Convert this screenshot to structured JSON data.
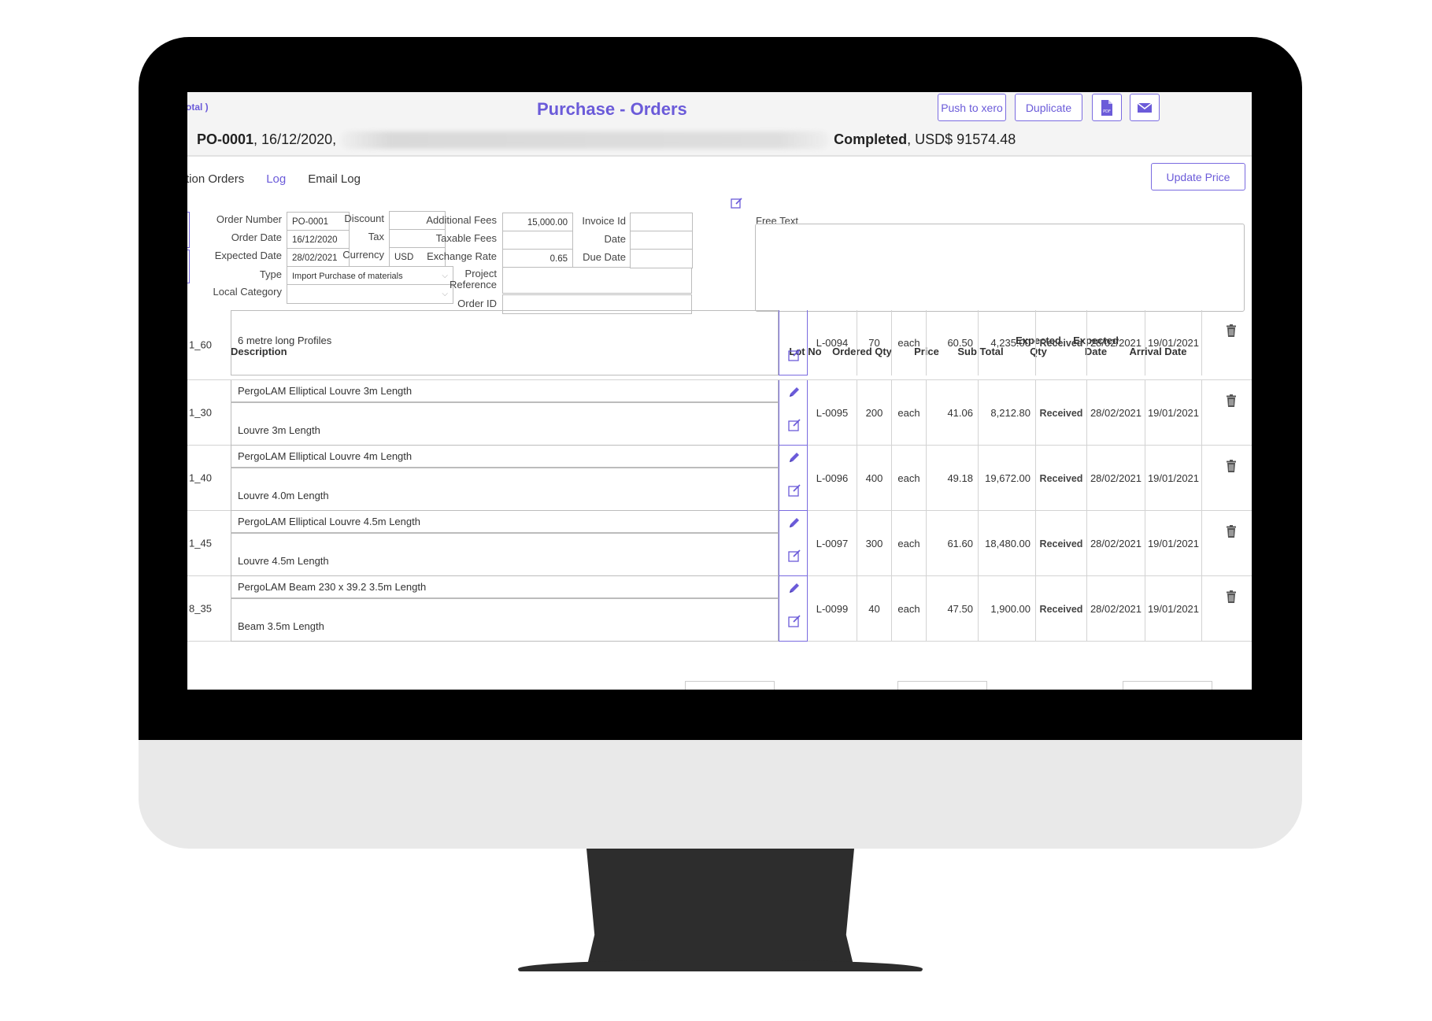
{
  "header": {
    "breadcrumb": "otal )",
    "title": "Purchase - Orders",
    "buttons": {
      "push_to_xero": "Push to xero",
      "duplicate": "Duplicate"
    },
    "po_number": "PO-0001",
    "po_date": ", 16/12/2020,",
    "status": "Completed",
    "amount": ", USD$ 91574.48"
  },
  "tabs": [
    {
      "label": "tion Orders",
      "active": false
    },
    {
      "label": "Log",
      "active": true
    },
    {
      "label": "Email Log",
      "active": false
    }
  ],
  "update_price_label": "Update Price",
  "form": {
    "order_number": {
      "label": "Order Number",
      "value": "PO-0001"
    },
    "order_date": {
      "label": "Order Date",
      "value": "16/12/2020"
    },
    "expected_date": {
      "label": "Expected Date",
      "value": "28/02/2021"
    },
    "type": {
      "label": "Type",
      "value": "Import Purchase of materials"
    },
    "local_category": {
      "label": "Local Category",
      "value": ""
    },
    "discount": {
      "label": "Discount",
      "value": ""
    },
    "tax": {
      "label": "Tax",
      "value": ""
    },
    "currency": {
      "label": "Currency",
      "value": "USD"
    },
    "additional_fees": {
      "label": "Additional Fees",
      "value": "15,000.00"
    },
    "taxable_fees": {
      "label": "Taxable Fees",
      "value": ""
    },
    "exchange_rate": {
      "label": "Exchange Rate",
      "value": "0.65"
    },
    "project_reference": {
      "label1": "Project",
      "label2": "Reference",
      "value": ""
    },
    "order_id": {
      "label": "Order ID",
      "value": ""
    },
    "invoice_id": {
      "label": "Invoice Id",
      "value": ""
    },
    "date": {
      "label": "Date",
      "value": ""
    },
    "due_date": {
      "label": "Due Date",
      "value": ""
    },
    "free_text": {
      "label": "Free Text",
      "value": ""
    }
  },
  "table": {
    "headers": {
      "description": "Description",
      "lot_no": "Lot  No",
      "ordered_qty": "Ordered Qty",
      "price": "Price",
      "sub_total": "Sub Total",
      "expected_qty_1": "Expected",
      "expected_qty_2": "Qty",
      "expected_date_1": "Expected",
      "expected_date_2": "Date",
      "arrival_date": "Arrival Date"
    },
    "rows": [
      {
        "code": "1_60",
        "title": "",
        "desc": "6 metre long Profiles",
        "lot": "L-0094",
        "qty": "70",
        "unit": "each",
        "price": "60.50",
        "subtotal": "4,235.00",
        "exp_qty": "Received",
        "exp_date": "28/02/2021",
        "arrival": "19/01/2021"
      },
      {
        "code": "1_30",
        "title": "PergoLAM Elliptical Louvre 3m Length",
        "desc": "Louvre 3m Length",
        "lot": "L-0095",
        "qty": "200",
        "unit": "each",
        "price": "41.06",
        "subtotal": "8,212.80",
        "exp_qty": "Received",
        "exp_date": "28/02/2021",
        "arrival": "19/01/2021"
      },
      {
        "code": "1_40",
        "title": "PergoLAM Elliptical Louvre 4m Length",
        "desc": "Louvre 4.0m Length",
        "lot": "L-0096",
        "qty": "400",
        "unit": "each",
        "price": "49.18",
        "subtotal": "19,672.00",
        "exp_qty": "Received",
        "exp_date": "28/02/2021",
        "arrival": "19/01/2021"
      },
      {
        "code": "1_45",
        "title": "PergoLAM Elliptical Louvre 4.5m Length",
        "desc": "Louvre 4.5m Length",
        "lot": "L-0097",
        "qty": "300",
        "unit": "each",
        "price": "61.60",
        "subtotal": "18,480.00",
        "exp_qty": "Received",
        "exp_date": "28/02/2021",
        "arrival": "19/01/2021"
      },
      {
        "code": "8_35",
        "title": "PergoLAM Beam 230 x 39.2  3.5m Length",
        "desc": "Beam 3.5m Length",
        "lot": "L-0099",
        "qty": "40",
        "unit": "each",
        "price": "47.50",
        "subtotal": "1,900.00",
        "exp_qty": "Received",
        "exp_date": "28/02/2021",
        "arrival": "19/01/2021"
      }
    ]
  },
  "icons": {
    "pdf": "pdf-icon",
    "email": "email-icon",
    "pencil": "pencil-icon",
    "edit": "edit-icon",
    "trash": "trash-icon",
    "dropdown": "chevron-down-icon"
  },
  "colors": {
    "accent": "#6b5bd9",
    "border": "#bcbcbc",
    "header_bg": "#f4f4f4"
  }
}
